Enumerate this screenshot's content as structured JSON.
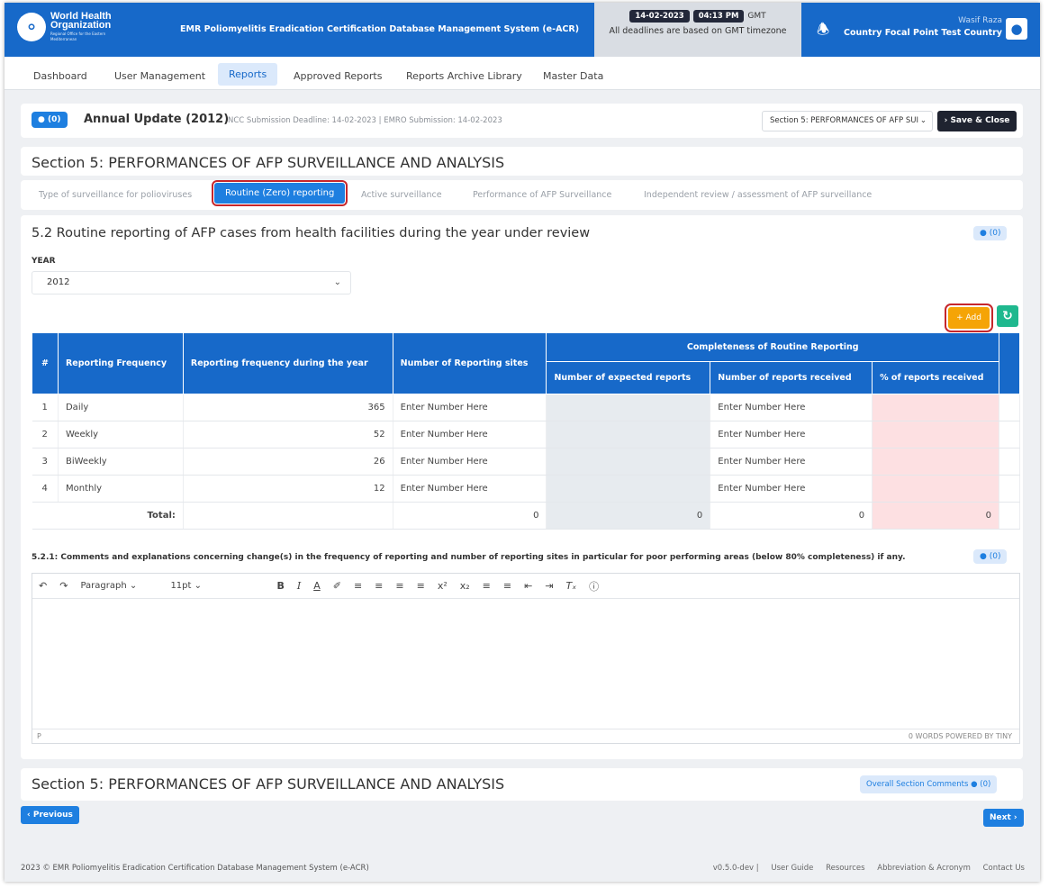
{
  "header": {
    "org_name": "World Health Organization",
    "org_region": "Regional Office for the Eastern Mediterranean",
    "app_title": "EMR Poliomyelitis Eradication Certification Database Management System (e-ACR)",
    "date": "14-02-2023",
    "time": "04:13 PM",
    "timezone": "GMT",
    "deadline_note": "All deadlines are based on GMT timezone",
    "user_name": "Wasif Raza",
    "user_role": "Country Focal Point Test Country"
  },
  "nav": [
    "Dashboard",
    "User Management",
    "Reports",
    "Approved Reports",
    "Reports Archive Library",
    "Master Data"
  ],
  "annual": {
    "comment_count": "(0)",
    "title": "Annual Update (2012)",
    "deadlines": "NCC Submission Deadline: 14-02-2023 | EMRO Submission: 14-02-2023",
    "section_select": "Section 5: PERFORMANCES OF AFP SUI",
    "save_close": "Save & Close"
  },
  "section_title": "Section 5: PERFORMANCES OF AFP SURVEILLANCE AND ANALYSIS",
  "subtabs": [
    "Type of surveillance for polioviruses",
    "Routine (Zero) reporting",
    "Active surveillance",
    "Performance of AFP Surveillance",
    "Independent review / assessment of AFP surveillance"
  ],
  "main": {
    "heading": "5.2 Routine reporting of AFP cases from health facilities during the year under review",
    "comment_count": "(0)",
    "year_label": "YEAR",
    "year_value": "2012",
    "add_label": "Add"
  },
  "table": {
    "headers": {
      "num": "#",
      "freq": "Reporting Frequency",
      "during": "Reporting frequency during the year",
      "sites": "Number of Reporting sites",
      "completeness": "Completeness of Routine Reporting",
      "expected": "Number of expected reports",
      "received": "Number of reports received",
      "pct": "% of reports received"
    },
    "rows": [
      {
        "num": "1",
        "freq": "Daily",
        "during": "365",
        "sites": "Enter Number Here",
        "received": "Enter Number Here"
      },
      {
        "num": "2",
        "freq": "Weekly",
        "during": "52",
        "sites": "Enter Number Here",
        "received": "Enter Number Here"
      },
      {
        "num": "3",
        "freq": "BiWeekly",
        "during": "26",
        "sites": "Enter Number Here",
        "received": "Enter Number Here"
      },
      {
        "num": "4",
        "freq": "Monthly",
        "during": "12",
        "sites": "Enter Number Here",
        "received": "Enter Number Here"
      }
    ],
    "total": {
      "label": "Total:",
      "sites": "0",
      "expected": "0",
      "received": "0",
      "pct": "0"
    }
  },
  "comments": {
    "label": "5.2.1: Comments and explanations concerning change(s) in the frequency of reporting and number of reporting sites in particular for poor performing areas (below 80% completeness) if any.",
    "comment_count": "(0)",
    "format": "Paragraph",
    "font_size": "11pt",
    "status_path": "P",
    "status_words": "0 WORDS  POWERED BY TINY"
  },
  "bottom": {
    "section_title": "Section 5: PERFORMANCES OF AFP SURVEILLANCE AND ANALYSIS",
    "overall_label": "Overall Section Comments",
    "overall_count": "(0)",
    "previous": "Previous",
    "next": "Next"
  },
  "footer": {
    "copyright": "2023 ©  EMR Poliomyelitis Eradication Certification Database Management System (e-ACR)",
    "version": "v0.5.0-dev",
    "links": [
      "User Guide",
      "Resources",
      "Abbreviation & Acronym",
      "Contact Us"
    ]
  },
  "colors": {
    "primary": "#1769c9",
    "accent_button": "#1e7fe0",
    "add_button": "#f5a406",
    "refresh_button": "#1fb88e",
    "highlight_outline": "#c6262b"
  }
}
